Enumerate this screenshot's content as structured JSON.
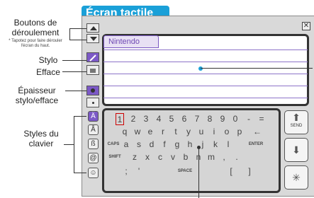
{
  "screen": {
    "title": "Écran tactile",
    "close_icon": "close-icon"
  },
  "labels": {
    "scroll": "Boutons de déroulement",
    "scroll_note": "* Tapotez pour faire dérouler l'écran du haut.",
    "pen": "Stylo",
    "eraser": "Efface",
    "thickness": "Épaisseur stylo/efface",
    "keyboard_styles": "Styles du clavier"
  },
  "note": {
    "tab_label": "Nintendo"
  },
  "keyboard": {
    "row1": [
      "1",
      "2",
      "3",
      "4",
      "5",
      "6",
      "7",
      "8",
      "9",
      "0",
      "-",
      "="
    ],
    "row2": [
      "q",
      "w",
      "e",
      "r",
      "t",
      "y",
      "u",
      "i",
      "o",
      "p",
      "←"
    ],
    "row3": [
      "CAPS",
      "a",
      "s",
      "d",
      "f",
      "g",
      "h",
      "j",
      "k",
      "l",
      "ENTER"
    ],
    "row4": [
      "SHIFT",
      "z",
      "x",
      "c",
      "v",
      "b",
      "n",
      "m",
      ",",
      "."
    ],
    "row5": [
      ";",
      "'",
      "SPACE",
      "[",
      "]"
    ]
  },
  "side_buttons": {
    "send": "SEND"
  },
  "colors": {
    "accent": "#1aa0d8",
    "note_line": "#8d73c9"
  }
}
